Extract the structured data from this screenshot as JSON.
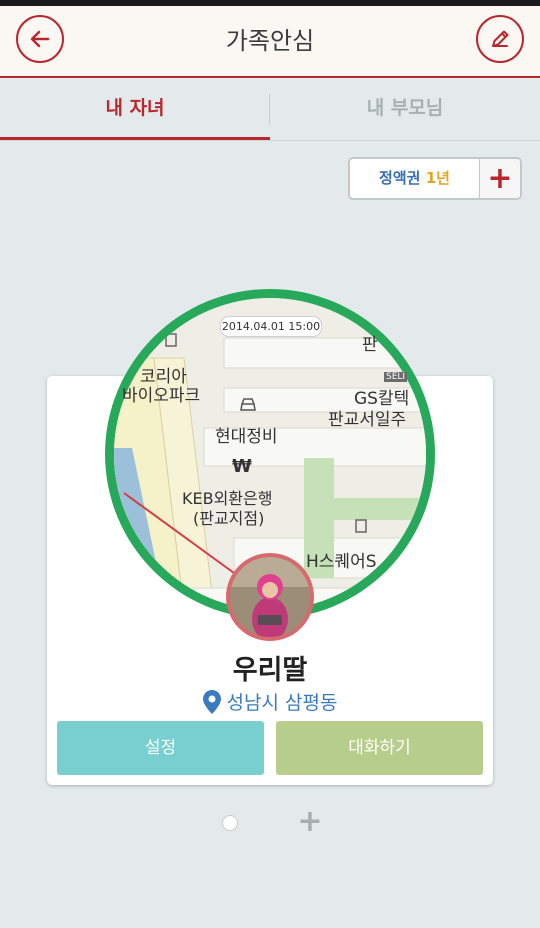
{
  "header": {
    "title": "가족안심",
    "back_icon": "back-arrow-icon",
    "edit_icon": "pencil-icon"
  },
  "tabs": [
    {
      "label": "내 자녀",
      "active": true
    },
    {
      "label": "내 부모님",
      "active": false
    }
  ],
  "voucher": {
    "label": "정액권",
    "period": "1년",
    "add_icon": "plus-icon"
  },
  "map": {
    "timestamp": "2014.04.01 15:00",
    "labels": {
      "korea_bio_park_1": "코리아",
      "korea_bio_park_2": "바이오파크",
      "gs_caltex_1": "GS칼텍",
      "gs_caltex_2": "판교서일주",
      "hyundai": "현대정비",
      "keb_1": "KEB외환은행",
      "keb_2": "(판교지점)",
      "h_square": "H스퀘어S",
      "top_right": "판",
      "seli": "SELI"
    }
  },
  "child": {
    "name": "우리딸",
    "location": "성남시 삼평동",
    "location_icon": "map-pin-icon"
  },
  "buttons": {
    "settings": "설정",
    "chat": "대화하기"
  },
  "pager": {
    "add_icon": "plus-icon"
  },
  "colors": {
    "brand": "#b8272d",
    "map_ring": "#27a85a",
    "settings_btn": "#79cfd0",
    "chat_btn": "#b7cd8c",
    "location_text": "#3a7bc0"
  }
}
